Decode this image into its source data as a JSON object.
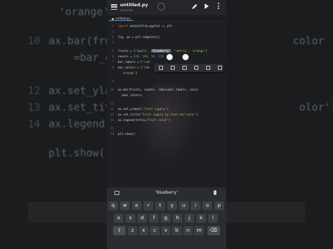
{
  "background": {
    "lines": [
      {
        "num": "",
        "text": "'orange'"
      },
      {
        "num": "",
        "text": "ax.bar(fru              ,              color"
      },
      {
        "num": "",
        "text": "    =bar_col"
      },
      {
        "num": "",
        "text": "ax.set_yla"
      },
      {
        "num": "",
        "text": "ax.set_tit                              olor')"
      },
      {
        "num": "",
        "text": "ax.legend("
      },
      {
        "num": "",
        "text": "plt.show()"
      }
    ],
    "line_numbers": [
      "",
      "10",
      "",
      "12",
      "13",
      "14",
      "",
      ""
    ]
  },
  "appbar": {
    "title": "untitled.py",
    "subtitle": "Saved file"
  },
  "tab": {
    "label": "untitled.py"
  },
  "editor": {
    "lines": [
      {
        "n": "1",
        "segments": [
          {
            "t": "import",
            "c": "kw"
          },
          {
            "t": " matplotlib.pyplot ",
            "c": ""
          },
          {
            "t": "as",
            "c": "kw"
          },
          {
            "t": " plt",
            "c": ""
          }
        ]
      },
      {
        "n": "2",
        "segments": []
      },
      {
        "n": "3",
        "segments": [
          {
            "t": "fig, ax = plt.subplots()",
            "c": ""
          }
        ]
      },
      {
        "n": "4",
        "segments": []
      },
      {
        "n": "5",
        "segments": [
          {
            "t": "fruits = [",
            "c": ""
          },
          {
            "t": "'apple'",
            "c": "str"
          },
          {
            "t": ", ",
            "c": ""
          },
          {
            "t": "'blueberry'",
            "c": "sel"
          },
          {
            "t": ", ",
            "c": ""
          },
          {
            "t": "'cherry'",
            "c": "str"
          },
          {
            "t": ", ",
            "c": ""
          },
          {
            "t": "'orange'",
            "c": "str"
          },
          {
            "t": "]",
            "c": ""
          }
        ]
      },
      {
        "n": "6",
        "segments": [
          {
            "t": "counts = [",
            "c": ""
          },
          {
            "t": "40, 100, 30, 55",
            "c": "num"
          },
          {
            "t": "]",
            "c": ""
          }
        ]
      },
      {
        "n": "7",
        "segments": [
          {
            "t": "bar_labels = [",
            "c": ""
          },
          {
            "t": "'red'",
            "c": "str"
          }
        ]
      },
      {
        "n": "8",
        "segments": [
          {
            "t": "bar_colors = [",
            "c": ""
          },
          {
            "t": "'tab",
            "c": "str"
          }
        ]
      },
      {
        "n": "",
        "segments": [
          {
            "t": "  ",
            "c": ""
          },
          {
            "t": "'orange'",
            "c": "str"
          },
          {
            "t": "]",
            "c": ""
          }
        ]
      },
      {
        "n": "9",
        "segments": []
      },
      {
        "n": "10",
        "segments": [
          {
            "t": "ax.bar(fruits, counts, label=bar_labels, color",
            "c": ""
          }
        ]
      },
      {
        "n": "",
        "segments": [
          {
            "t": "  =bar_colors)",
            "c": ""
          }
        ]
      },
      {
        "n": "11",
        "segments": []
      },
      {
        "n": "12",
        "segments": [
          {
            "t": "ax.set_ylabel(",
            "c": ""
          },
          {
            "t": "'fruit supply'",
            "c": "str"
          },
          {
            "t": ")",
            "c": ""
          }
        ]
      },
      {
        "n": "13",
        "segments": [
          {
            "t": "ax.set_title(",
            "c": ""
          },
          {
            "t": "'Fruit supply by kind and color'",
            "c": "str"
          },
          {
            "t": ")",
            "c": ""
          }
        ]
      },
      {
        "n": "14",
        "segments": [
          {
            "t": "ax.legend(title=",
            "c": ""
          },
          {
            "t": "'Fruit color'",
            "c": "str"
          },
          {
            "t": ")",
            "c": ""
          }
        ]
      },
      {
        "n": "15",
        "segments": []
      },
      {
        "n": "16",
        "segments": [
          {
            "t": "plt.show()",
            "c": ""
          }
        ]
      }
    ]
  },
  "context_menu": {
    "buttons": [
      "select-all-icon",
      "cut-icon",
      "copy-icon",
      "paste-icon",
      "format-icon",
      "more-icon"
    ]
  },
  "keyboard": {
    "suggestion": "'blueberry'",
    "row1": [
      "q",
      "w",
      "e",
      "r",
      "t",
      "y",
      "u",
      "i",
      "o",
      "p"
    ],
    "row2": [
      "a",
      "s",
      "d",
      "f",
      "g",
      "h",
      "j",
      "k",
      "l"
    ],
    "row3": [
      "z",
      "x",
      "c",
      "v",
      "b",
      "n",
      "m"
    ],
    "shift_symbol": "⇧",
    "backspace_symbol": "⌫"
  },
  "colors": {
    "background": "#1a1c1e",
    "editor_bg": "#1e1f22",
    "keyword": "#cc7832",
    "string": "#a5c25c",
    "number": "#6897bb",
    "selection": "#5a6470",
    "tab_accent": "#4b8fe2"
  }
}
